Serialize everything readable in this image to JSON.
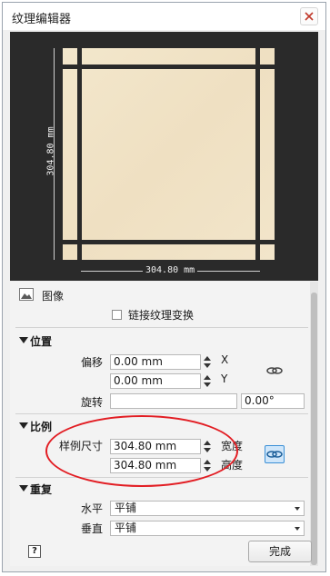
{
  "window": {
    "title": "纹理编辑器"
  },
  "preview": {
    "width_dim": "304.80 mm",
    "height_dim": "304.80 mm"
  },
  "image_section": {
    "label": "图像",
    "link_transform_label": "链接纹理变换",
    "link_transform_checked": false
  },
  "position": {
    "section_label": "位置",
    "offset_label": "偏移",
    "offset_x_value": "0.00 mm",
    "offset_y_value": "0.00 mm",
    "x_label": "X",
    "y_label": "Y",
    "rotate_label": "旋转",
    "rotate_value": "",
    "rotate_angle": "0.00°"
  },
  "scale": {
    "section_label": "比例",
    "sample_size_label": "样例尺寸",
    "width_value": "304.80 mm",
    "height_value": "304.80 mm",
    "width_label": "宽度",
    "height_label": "高度"
  },
  "repeat": {
    "section_label": "重复",
    "horizontal_label": "水平",
    "horizontal_value": "平铺",
    "vertical_label": "垂直",
    "vertical_value": "平铺"
  },
  "footer": {
    "help_label": "?",
    "done_label": "完成"
  },
  "colors": {
    "accent": "#3a8fd6",
    "annotation_ellipse": "#e21d23"
  }
}
